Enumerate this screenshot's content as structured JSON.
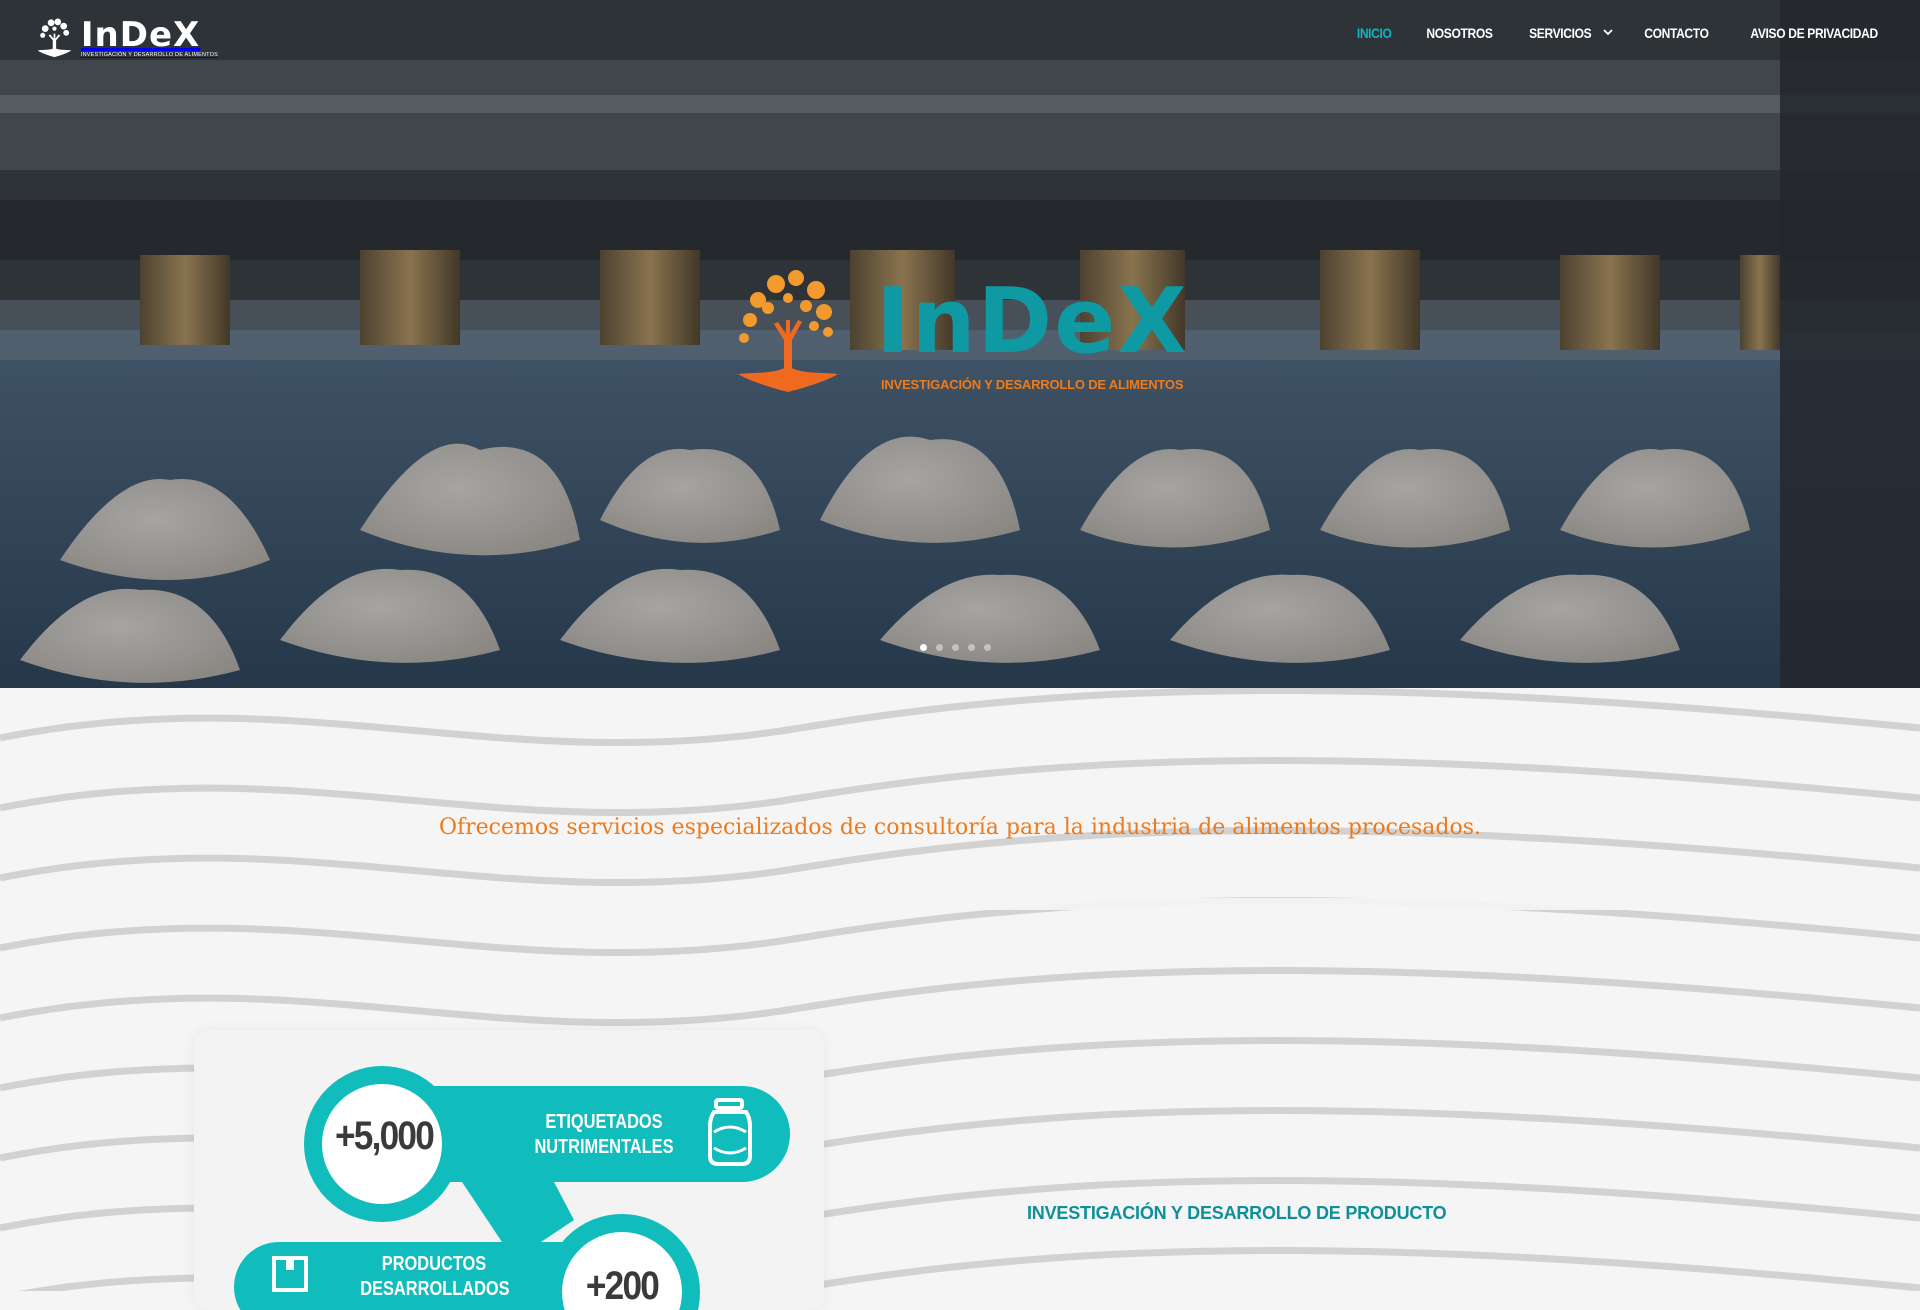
{
  "header": {
    "logo": {
      "word": "InDeX",
      "subtitle": "INVESTIGACIÓN Y DESARROLLO DE ALIMENTOS"
    },
    "nav": [
      {
        "label": "INICIO",
        "active": true
      },
      {
        "label": "NOSOTROS",
        "active": false
      },
      {
        "label": "SERVICIOS",
        "active": false,
        "has_dropdown": true
      },
      {
        "label": "CONTACTO",
        "active": false
      },
      {
        "label": "AVISO DE PRIVACIDAD",
        "active": false
      }
    ]
  },
  "hero": {
    "brand": "InDeX",
    "tagline": "INVESTIGACIÓN Y DESARROLLO DE ALIMENTOS",
    "slider": {
      "total": 5,
      "current": 1
    }
  },
  "intro": {
    "text": "Ofrecemos servicios especializados de consultoría para la industria de alimentos procesados."
  },
  "stats": [
    {
      "value": "+5,000",
      "label_line1": "ETIQUETADOS",
      "label_line2": "NUTRIMENTALES",
      "icon": "jar-icon"
    },
    {
      "value": "+200",
      "label_line1": "PRODUCTOS",
      "label_line2": "DESARROLLADOS",
      "icon": "box-icon"
    }
  ],
  "service": {
    "title": "INVESTIGACIÓN Y DESARROLLO DE PRODUCTO"
  },
  "colors": {
    "teal": "#0fb5c1",
    "teal_dark": "#0f8f9a",
    "orange": "#ef7a1a",
    "stat_teal": "#10bcbc"
  }
}
